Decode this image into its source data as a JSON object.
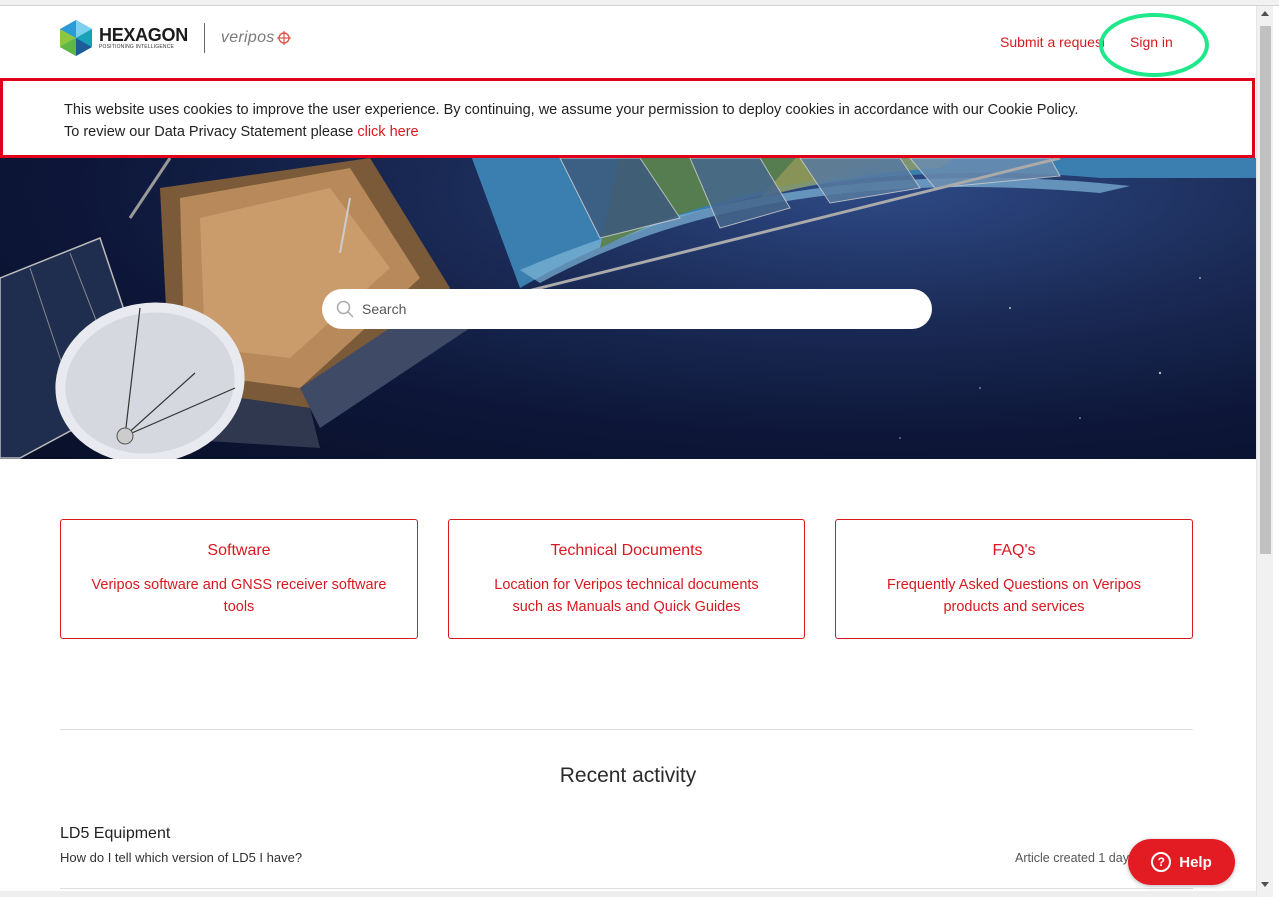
{
  "header": {
    "brand": "HEXAGON",
    "brand_sub": "POSITIONING INTELLIGENCE",
    "partner": "veripos",
    "nav": {
      "submit_request": "Submit a request",
      "sign_in": "Sign in"
    }
  },
  "cookie_banner": {
    "line1": "This website uses cookies to improve the user experience. By continuing, we assume your permission to deploy cookies in accordance with our Cookie Policy.",
    "line2_prefix": "To review our Data Privacy Statement please ",
    "line2_link": "click here"
  },
  "search": {
    "placeholder": "Search"
  },
  "cards": [
    {
      "title": "Software",
      "description": "Veripos software and GNSS receiver software tools"
    },
    {
      "title": "Technical Documents",
      "description": "Location for Veripos technical documents such as Manuals and Quick Guides"
    },
    {
      "title": "FAQ's",
      "description": "Frequently Asked Questions on Veripos products and services"
    }
  ],
  "recent_activity": {
    "title": "Recent activity",
    "items": [
      {
        "section": "LD5 Equipment",
        "article": "How do I tell which version of LD5 I have?",
        "meta": "Article created 1 day ago"
      }
    ]
  },
  "help_button": {
    "label": "Help"
  },
  "colors": {
    "brand_red": "#d71920",
    "banner_border": "#e1001a",
    "annotation": "#1de98b",
    "help_bg": "#e31b23"
  }
}
